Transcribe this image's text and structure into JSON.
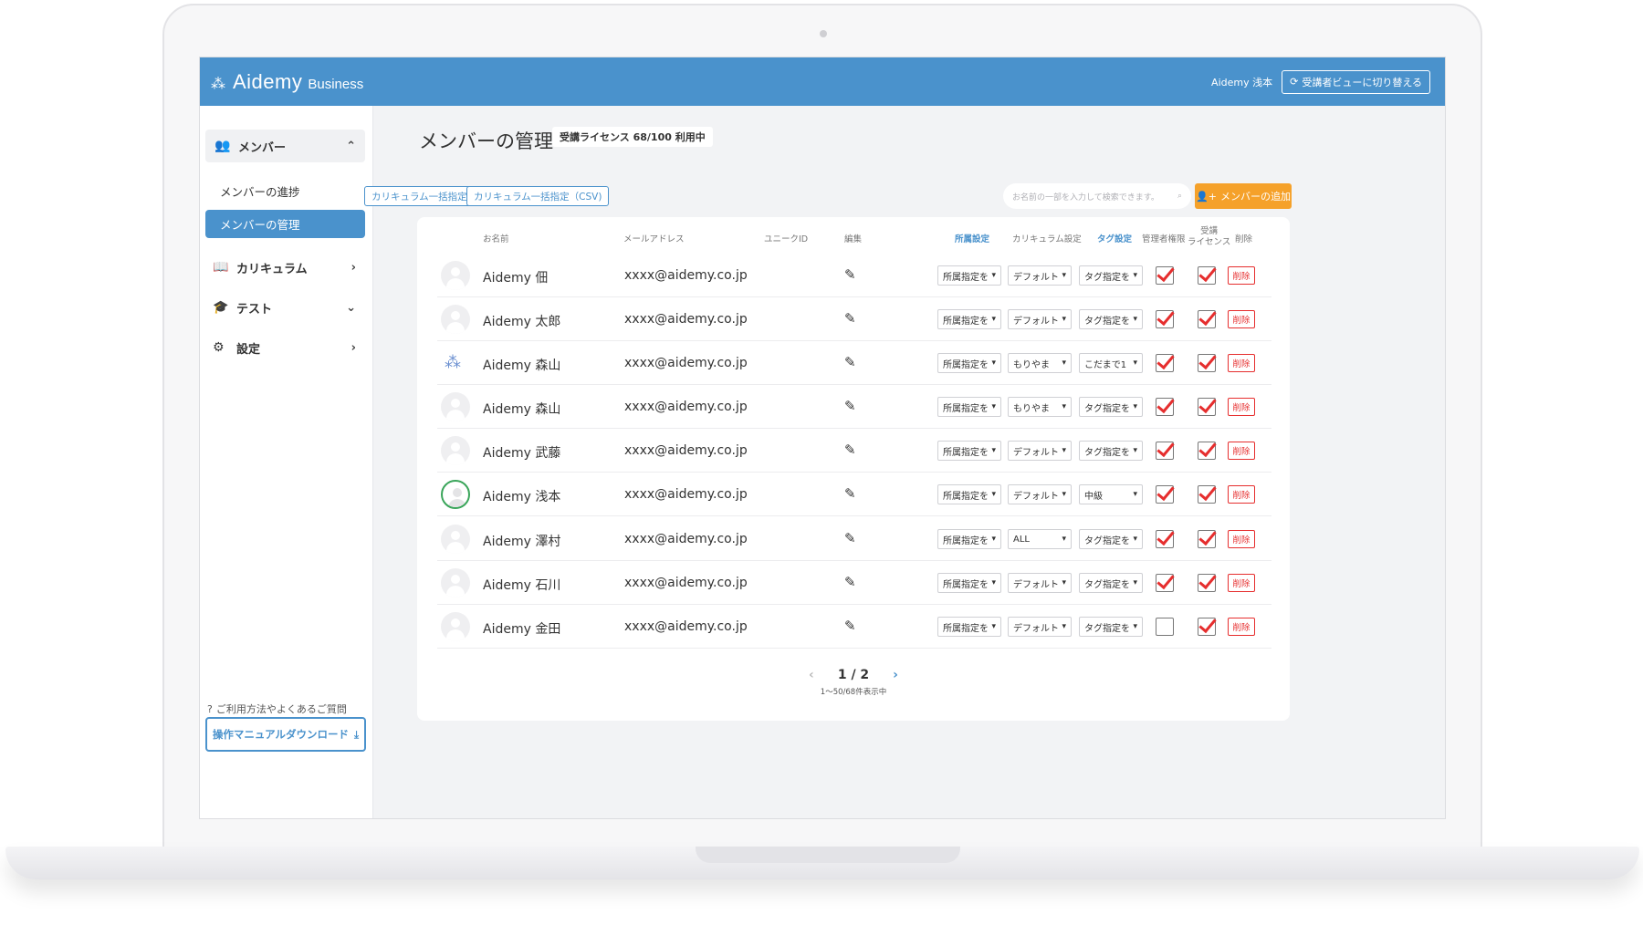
{
  "header": {
    "logo_text": "Aidemy",
    "logo_sub": "Business",
    "user_name": "Aidemy 浅本",
    "switch_label": "受講者ビューに切り替える"
  },
  "sidebar": {
    "members": "メンバー",
    "progress": "メンバーの進捗",
    "manage": "メンバーの管理",
    "curriculum": "カリキュラム",
    "test": "テスト",
    "settings": "設定",
    "help": "ご利用方法やよくあるご質問",
    "manual": "操作マニュアルダウンロード"
  },
  "main": {
    "title": "メンバーの管理",
    "license": "受講ライセンス 68/100 利用中",
    "bulk_curriculum": "カリキュラム一括指定",
    "bulk_curriculum_csv": "カリキュラム一括指定（CSV)",
    "search_placeholder": "お名前の一部を入力して検索できます。",
    "add_member": "メンバーの追加"
  },
  "table": {
    "headers": {
      "name": "お名前",
      "email": "メールアドレス",
      "unique_id": "ユニークID",
      "edit": "編集",
      "dept": "所属設定",
      "curriculum": "カリキュラム設定",
      "tag": "タグ設定",
      "admin": "管理者権限",
      "license_1": "受講",
      "license_2": "ライセンス",
      "delete": "削除"
    },
    "delete_label": "削除",
    "rows": [
      {
        "name": "Aidemy 佃",
        "email": "xxxx@aidemy.co.jp",
        "dept": "所属指定を",
        "curriculum": "デフォルト",
        "tag": "タグ指定を",
        "admin": true,
        "license": true,
        "avatar": "default"
      },
      {
        "name": "Aidemy 太郎",
        "email": "xxxx@aidemy.co.jp",
        "dept": "所属指定を",
        "curriculum": "デフォルト",
        "tag": "タグ指定を",
        "admin": true,
        "license": true,
        "avatar": "default"
      },
      {
        "name": "Aidemy 森山",
        "email": "xxxx@aidemy.co.jp",
        "dept": "所属指定を",
        "curriculum": "もりやま",
        "tag": "こだまで1",
        "admin": true,
        "license": true,
        "avatar": "logo"
      },
      {
        "name": "Aidemy 森山",
        "email": "xxxx@aidemy.co.jp",
        "dept": "所属指定を",
        "curriculum": "もりやま",
        "tag": "タグ指定を",
        "admin": true,
        "license": true,
        "avatar": "default"
      },
      {
        "name": "Aidemy 武藤",
        "email": "xxxx@aidemy.co.jp",
        "dept": "所属指定を",
        "curriculum": "デフォルト",
        "tag": "タグ指定を",
        "admin": true,
        "license": true,
        "avatar": "default"
      },
      {
        "name": "Aidemy 浅本",
        "email": "xxxx@aidemy.co.jp",
        "dept": "所属指定を",
        "curriculum": "デフォルト",
        "tag": "中級",
        "admin": true,
        "license": true,
        "avatar": "ring"
      },
      {
        "name": "Aidemy 澤村",
        "email": "xxxx@aidemy.co.jp",
        "dept": "所属指定を",
        "curriculum": "ALL",
        "tag": "タグ指定を",
        "admin": true,
        "license": true,
        "avatar": "default"
      },
      {
        "name": "Aidemy 石川",
        "email": "xxxx@aidemy.co.jp",
        "dept": "所属指定を",
        "curriculum": "デフォルト",
        "tag": "タグ指定を",
        "admin": true,
        "license": true,
        "avatar": "default"
      },
      {
        "name": "Aidemy 金田",
        "email": "xxxx@aidemy.co.jp",
        "dept": "所属指定を",
        "curriculum": "デフォルト",
        "tag": "タグ指定を",
        "admin": false,
        "license": true,
        "avatar": "default"
      }
    ]
  },
  "pager": {
    "page": "1 / 2",
    "count": "1〜50/68件表示中"
  }
}
